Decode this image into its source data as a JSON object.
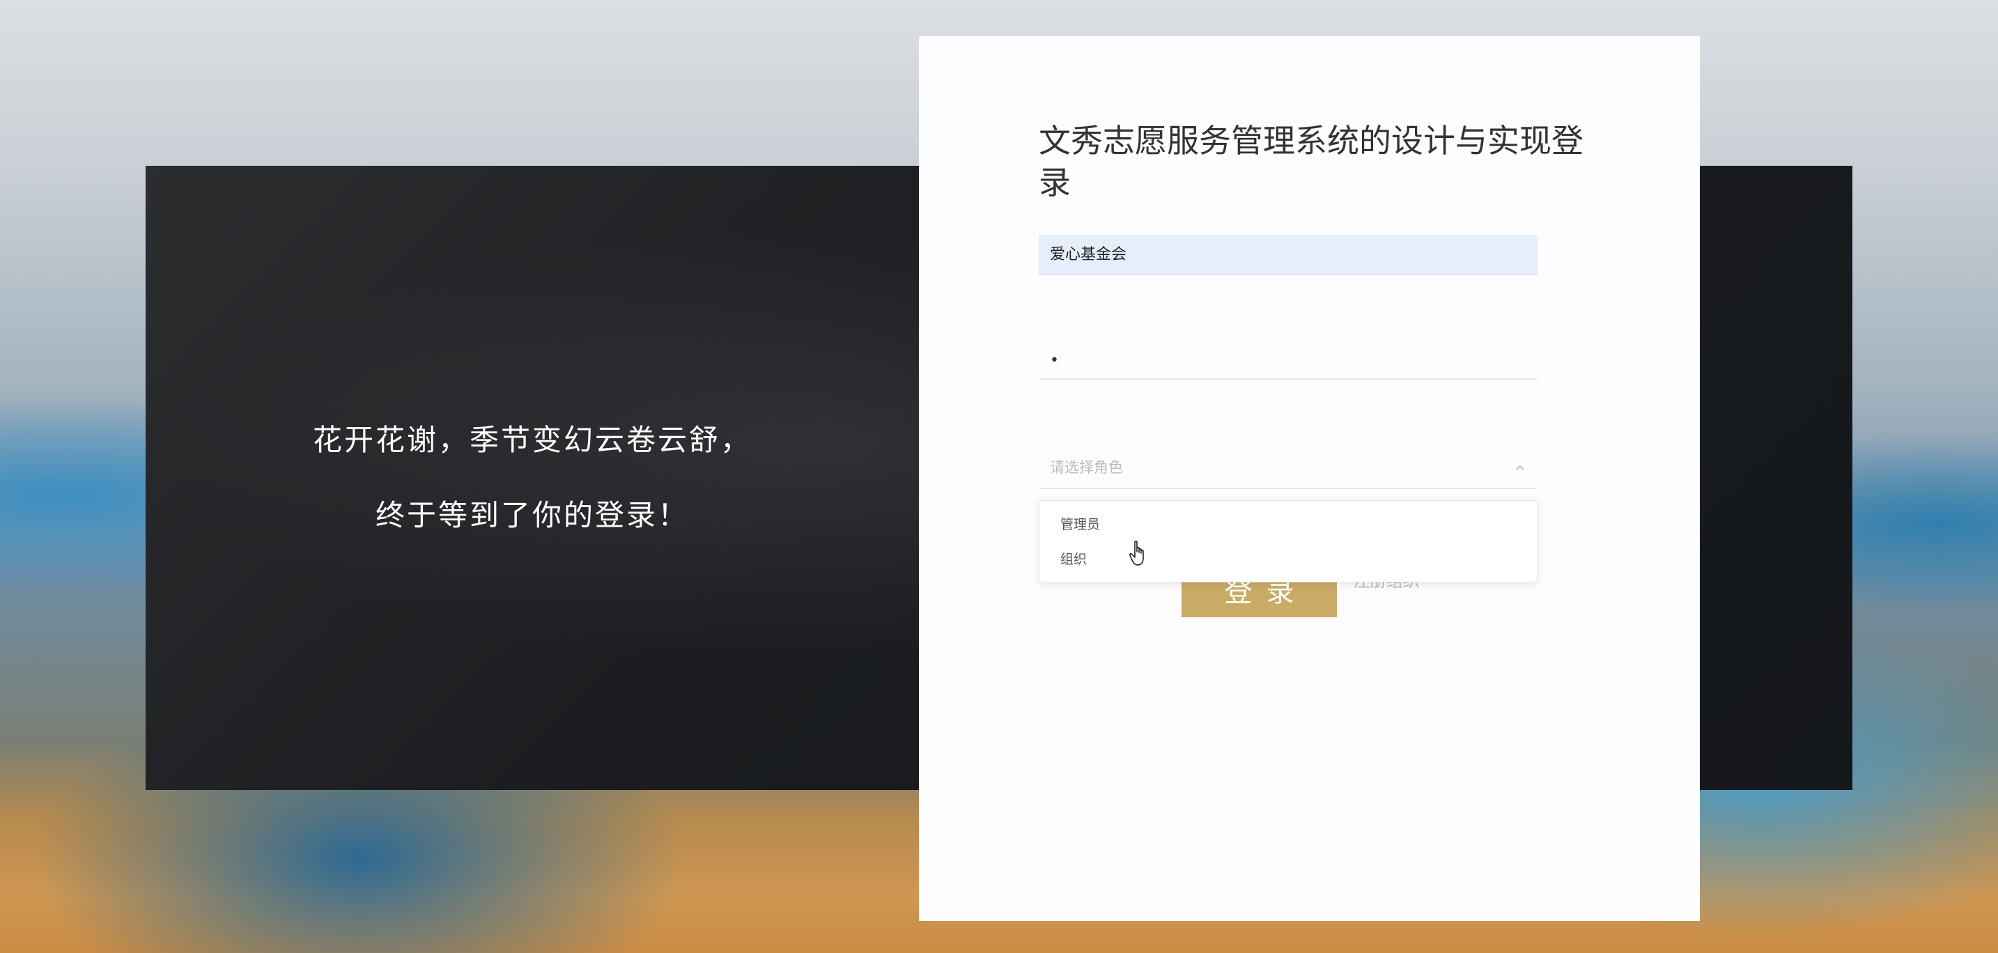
{
  "slogan": {
    "line1": "花开花谢，季节变幻云卷云舒，",
    "line2": "终于等到了你的登录！"
  },
  "login": {
    "title": "文秀志愿服务管理系统的设计与实现登录",
    "org_value": "爱心基金会",
    "password_value": "•",
    "role_placeholder": "请选择角色",
    "role_options": [
      "管理员",
      "组织"
    ],
    "login_button": "登录",
    "register_link": "注册组织"
  },
  "icons": {
    "dropdown_arrow": "chevron-up-icon",
    "cursor": "hand-pointer-icon"
  },
  "colors": {
    "accent": "#c9ab66",
    "input_autofill": "#e6edfb",
    "card": "#fdfcfe"
  }
}
